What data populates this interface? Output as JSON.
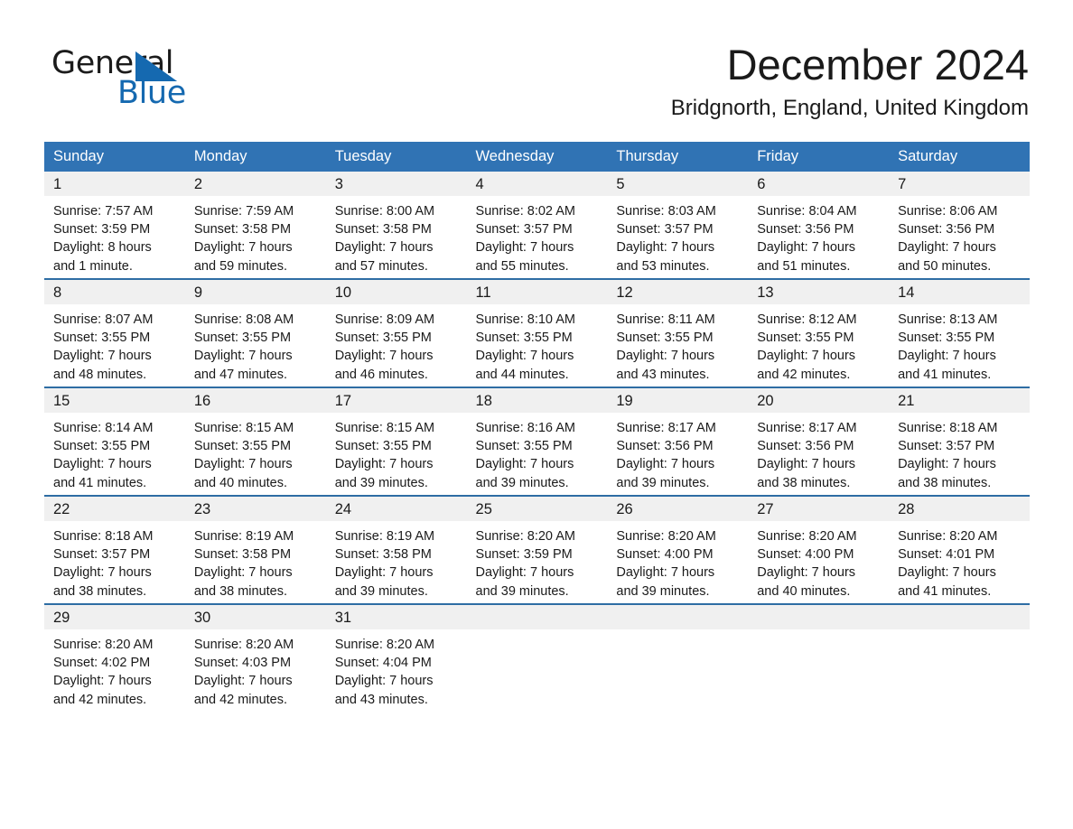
{
  "brand": {
    "name_part1": "General",
    "name_part2": "Blue",
    "accent_color": "#1569b0",
    "triangle_icon": "blue-triangle-icon"
  },
  "header": {
    "month_title": "December 2024",
    "location": "Bridgnorth, England, United Kingdom"
  },
  "colors": {
    "header_blue": "#3073b4",
    "row_divider_blue": "#2e6da4",
    "daynum_band": "#f0f0f0",
    "text": "#1a1a1a"
  },
  "calendar": {
    "weekday_headers": [
      "Sunday",
      "Monday",
      "Tuesday",
      "Wednesday",
      "Thursday",
      "Friday",
      "Saturday"
    ],
    "weeks": [
      [
        {
          "day": "1",
          "sunrise": "Sunrise: 7:57 AM",
          "sunset": "Sunset: 3:59 PM",
          "daylight_line1": "Daylight: 8 hours",
          "daylight_line2": "and 1 minute."
        },
        {
          "day": "2",
          "sunrise": "Sunrise: 7:59 AM",
          "sunset": "Sunset: 3:58 PM",
          "daylight_line1": "Daylight: 7 hours",
          "daylight_line2": "and 59 minutes."
        },
        {
          "day": "3",
          "sunrise": "Sunrise: 8:00 AM",
          "sunset": "Sunset: 3:58 PM",
          "daylight_line1": "Daylight: 7 hours",
          "daylight_line2": "and 57 minutes."
        },
        {
          "day": "4",
          "sunrise": "Sunrise: 8:02 AM",
          "sunset": "Sunset: 3:57 PM",
          "daylight_line1": "Daylight: 7 hours",
          "daylight_line2": "and 55 minutes."
        },
        {
          "day": "5",
          "sunrise": "Sunrise: 8:03 AM",
          "sunset": "Sunset: 3:57 PM",
          "daylight_line1": "Daylight: 7 hours",
          "daylight_line2": "and 53 minutes."
        },
        {
          "day": "6",
          "sunrise": "Sunrise: 8:04 AM",
          "sunset": "Sunset: 3:56 PM",
          "daylight_line1": "Daylight: 7 hours",
          "daylight_line2": "and 51 minutes."
        },
        {
          "day": "7",
          "sunrise": "Sunrise: 8:06 AM",
          "sunset": "Sunset: 3:56 PM",
          "daylight_line1": "Daylight: 7 hours",
          "daylight_line2": "and 50 minutes."
        }
      ],
      [
        {
          "day": "8",
          "sunrise": "Sunrise: 8:07 AM",
          "sunset": "Sunset: 3:55 PM",
          "daylight_line1": "Daylight: 7 hours",
          "daylight_line2": "and 48 minutes."
        },
        {
          "day": "9",
          "sunrise": "Sunrise: 8:08 AM",
          "sunset": "Sunset: 3:55 PM",
          "daylight_line1": "Daylight: 7 hours",
          "daylight_line2": "and 47 minutes."
        },
        {
          "day": "10",
          "sunrise": "Sunrise: 8:09 AM",
          "sunset": "Sunset: 3:55 PM",
          "daylight_line1": "Daylight: 7 hours",
          "daylight_line2": "and 46 minutes."
        },
        {
          "day": "11",
          "sunrise": "Sunrise: 8:10 AM",
          "sunset": "Sunset: 3:55 PM",
          "daylight_line1": "Daylight: 7 hours",
          "daylight_line2": "and 44 minutes."
        },
        {
          "day": "12",
          "sunrise": "Sunrise: 8:11 AM",
          "sunset": "Sunset: 3:55 PM",
          "daylight_line1": "Daylight: 7 hours",
          "daylight_line2": "and 43 minutes."
        },
        {
          "day": "13",
          "sunrise": "Sunrise: 8:12 AM",
          "sunset": "Sunset: 3:55 PM",
          "daylight_line1": "Daylight: 7 hours",
          "daylight_line2": "and 42 minutes."
        },
        {
          "day": "14",
          "sunrise": "Sunrise: 8:13 AM",
          "sunset": "Sunset: 3:55 PM",
          "daylight_line1": "Daylight: 7 hours",
          "daylight_line2": "and 41 minutes."
        }
      ],
      [
        {
          "day": "15",
          "sunrise": "Sunrise: 8:14 AM",
          "sunset": "Sunset: 3:55 PM",
          "daylight_line1": "Daylight: 7 hours",
          "daylight_line2": "and 41 minutes."
        },
        {
          "day": "16",
          "sunrise": "Sunrise: 8:15 AM",
          "sunset": "Sunset: 3:55 PM",
          "daylight_line1": "Daylight: 7 hours",
          "daylight_line2": "and 40 minutes."
        },
        {
          "day": "17",
          "sunrise": "Sunrise: 8:15 AM",
          "sunset": "Sunset: 3:55 PM",
          "daylight_line1": "Daylight: 7 hours",
          "daylight_line2": "and 39 minutes."
        },
        {
          "day": "18",
          "sunrise": "Sunrise: 8:16 AM",
          "sunset": "Sunset: 3:55 PM",
          "daylight_line1": "Daylight: 7 hours",
          "daylight_line2": "and 39 minutes."
        },
        {
          "day": "19",
          "sunrise": "Sunrise: 8:17 AM",
          "sunset": "Sunset: 3:56 PM",
          "daylight_line1": "Daylight: 7 hours",
          "daylight_line2": "and 39 minutes."
        },
        {
          "day": "20",
          "sunrise": "Sunrise: 8:17 AM",
          "sunset": "Sunset: 3:56 PM",
          "daylight_line1": "Daylight: 7 hours",
          "daylight_line2": "and 38 minutes."
        },
        {
          "day": "21",
          "sunrise": "Sunrise: 8:18 AM",
          "sunset": "Sunset: 3:57 PM",
          "daylight_line1": "Daylight: 7 hours",
          "daylight_line2": "and 38 minutes."
        }
      ],
      [
        {
          "day": "22",
          "sunrise": "Sunrise: 8:18 AM",
          "sunset": "Sunset: 3:57 PM",
          "daylight_line1": "Daylight: 7 hours",
          "daylight_line2": "and 38 minutes."
        },
        {
          "day": "23",
          "sunrise": "Sunrise: 8:19 AM",
          "sunset": "Sunset: 3:58 PM",
          "daylight_line1": "Daylight: 7 hours",
          "daylight_line2": "and 38 minutes."
        },
        {
          "day": "24",
          "sunrise": "Sunrise: 8:19 AM",
          "sunset": "Sunset: 3:58 PM",
          "daylight_line1": "Daylight: 7 hours",
          "daylight_line2": "and 39 minutes."
        },
        {
          "day": "25",
          "sunrise": "Sunrise: 8:20 AM",
          "sunset": "Sunset: 3:59 PM",
          "daylight_line1": "Daylight: 7 hours",
          "daylight_line2": "and 39 minutes."
        },
        {
          "day": "26",
          "sunrise": "Sunrise: 8:20 AM",
          "sunset": "Sunset: 4:00 PM",
          "daylight_line1": "Daylight: 7 hours",
          "daylight_line2": "and 39 minutes."
        },
        {
          "day": "27",
          "sunrise": "Sunrise: 8:20 AM",
          "sunset": "Sunset: 4:00 PM",
          "daylight_line1": "Daylight: 7 hours",
          "daylight_line2": "and 40 minutes."
        },
        {
          "day": "28",
          "sunrise": "Sunrise: 8:20 AM",
          "sunset": "Sunset: 4:01 PM",
          "daylight_line1": "Daylight: 7 hours",
          "daylight_line2": "and 41 minutes."
        }
      ],
      [
        {
          "day": "29",
          "sunrise": "Sunrise: 8:20 AM",
          "sunset": "Sunset: 4:02 PM",
          "daylight_line1": "Daylight: 7 hours",
          "daylight_line2": "and 42 minutes."
        },
        {
          "day": "30",
          "sunrise": "Sunrise: 8:20 AM",
          "sunset": "Sunset: 4:03 PM",
          "daylight_line1": "Daylight: 7 hours",
          "daylight_line2": "and 42 minutes."
        },
        {
          "day": "31",
          "sunrise": "Sunrise: 8:20 AM",
          "sunset": "Sunset: 4:04 PM",
          "daylight_line1": "Daylight: 7 hours",
          "daylight_line2": "and 43 minutes."
        },
        {
          "day": "",
          "sunrise": "",
          "sunset": "",
          "daylight_line1": "",
          "daylight_line2": ""
        },
        {
          "day": "",
          "sunrise": "",
          "sunset": "",
          "daylight_line1": "",
          "daylight_line2": ""
        },
        {
          "day": "",
          "sunrise": "",
          "sunset": "",
          "daylight_line1": "",
          "daylight_line2": ""
        },
        {
          "day": "",
          "sunrise": "",
          "sunset": "",
          "daylight_line1": "",
          "daylight_line2": ""
        }
      ]
    ]
  }
}
